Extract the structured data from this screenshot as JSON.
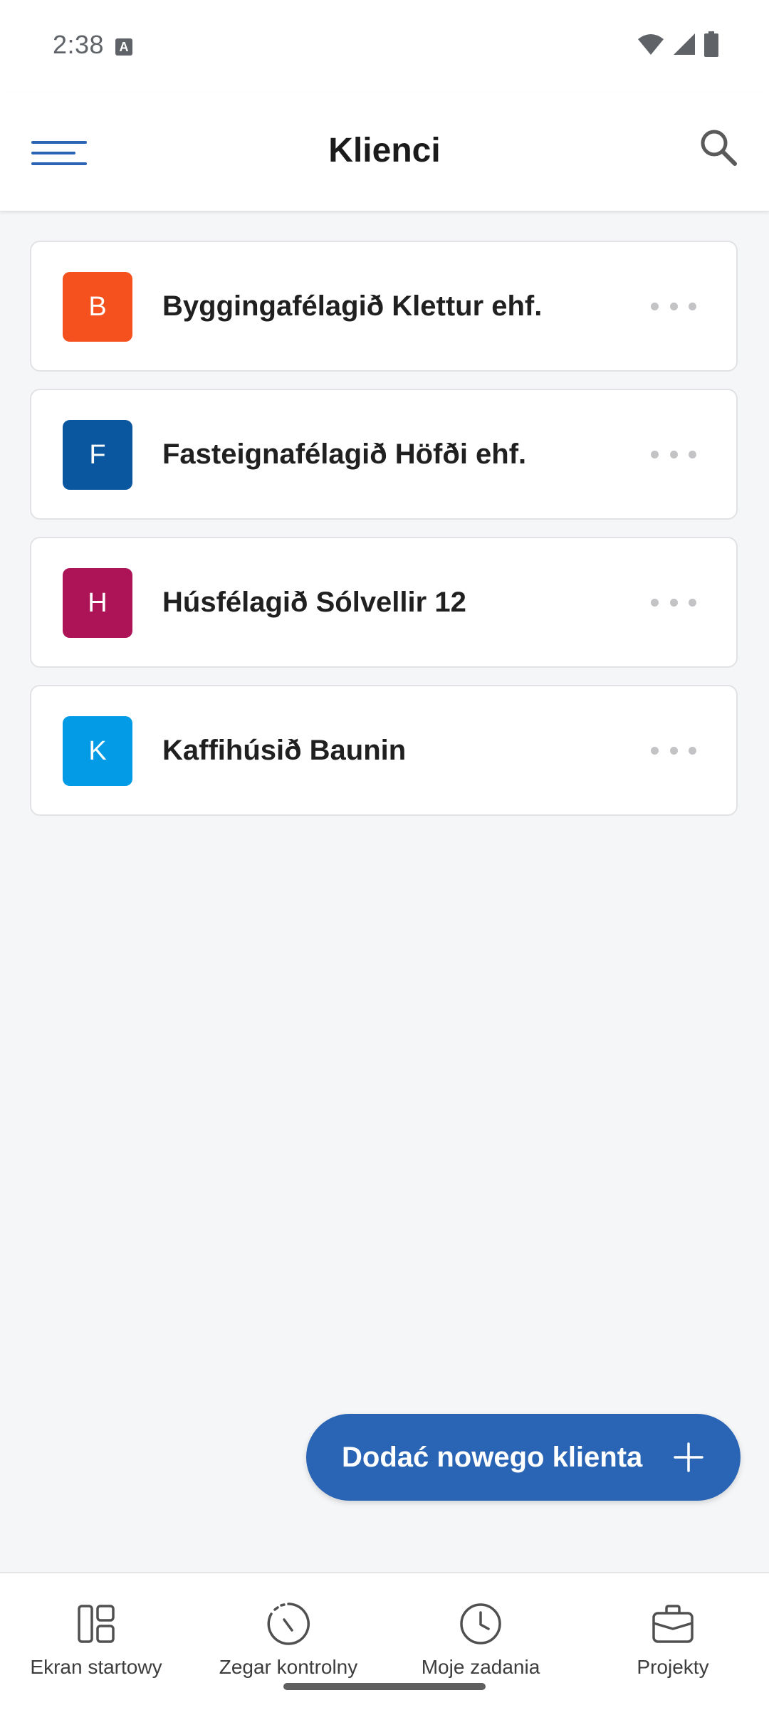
{
  "status_bar": {
    "time": "2:38",
    "notification_icon": "a-icon",
    "icons": [
      "wifi-icon",
      "signal-icon",
      "battery-icon"
    ]
  },
  "app_bar": {
    "title": "Klienci",
    "menu_icon": "menu-icon",
    "search_icon": "search-icon",
    "accent_color": "#2b64b5"
  },
  "clients": [
    {
      "initial": "B",
      "name": "Byggingafélagið Klettur ehf.",
      "color": "#f4511e"
    },
    {
      "initial": "F",
      "name": "Fasteignafélagið Höfði ehf.",
      "color": "#0b579f"
    },
    {
      "initial": "H",
      "name": "Húsfélagið Sólvellir 12",
      "color": "#ad1457"
    },
    {
      "initial": "K",
      "name": "Kaffihúsið Baunin",
      "color": "#039be5"
    }
  ],
  "fab": {
    "label": "Dodać nowego klienta",
    "icon": "plus-icon",
    "color": "#2a65b5"
  },
  "bottom_nav": {
    "items": [
      {
        "label": "Ekran startowy",
        "icon": "dashboard-icon"
      },
      {
        "label": "Zegar kontrolny",
        "icon": "timer-icon"
      },
      {
        "label": "Moje zadania",
        "icon": "clock-icon"
      },
      {
        "label": "Projekty",
        "icon": "briefcase-icon"
      }
    ]
  }
}
